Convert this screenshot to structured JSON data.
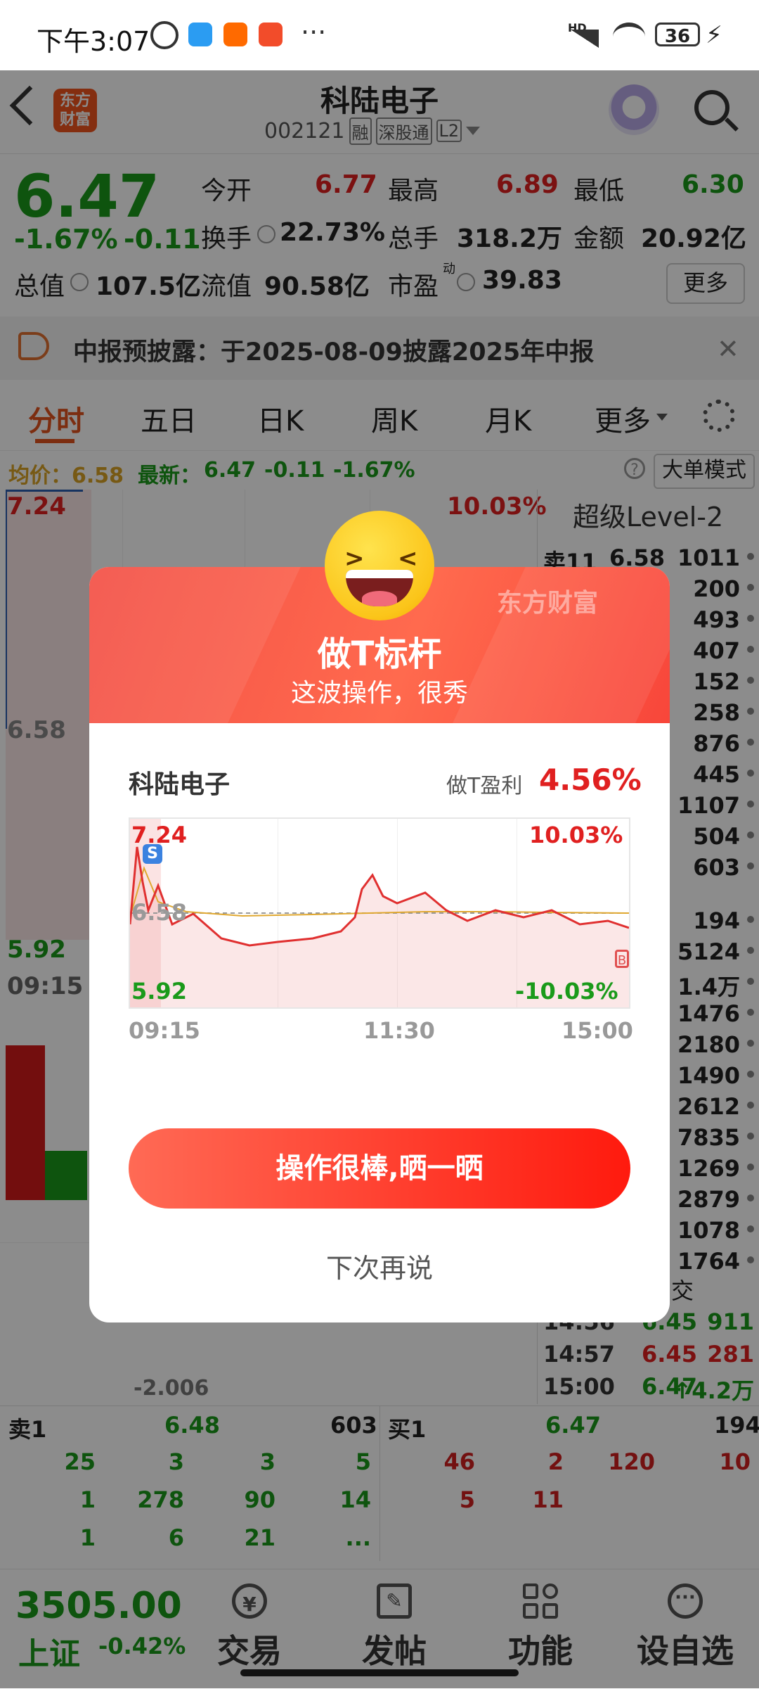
{
  "status_bar": {
    "time": "下午3:07",
    "dots": "···",
    "signal_label": "HD",
    "battery": "36"
  },
  "header": {
    "back_icon": "back-arrow-icon",
    "logo_text": "东方\n财富",
    "stock_name": "科陆电子",
    "stock_code": "002121",
    "tags": [
      "融",
      "深股通",
      "L2"
    ],
    "robot_icon": "robot-avatar-icon",
    "search_icon": "search-icon"
  },
  "quote": {
    "price": "6.47",
    "change_pct": "-1.67%",
    "change_abs": "-0.11",
    "fields": [
      {
        "label": "今开",
        "value": "6.77",
        "color": "#e02020"
      },
      {
        "label": "最高",
        "value": "6.89",
        "color": "#e02020"
      },
      {
        "label": "最低",
        "value": "6.30",
        "color": "#1a9a1a"
      },
      {
        "label": "换手",
        "value": "22.73%",
        "color": "#222222"
      },
      {
        "label": "总手",
        "value": "318.2万",
        "color": "#222222"
      },
      {
        "label": "金额",
        "value": "20.92亿",
        "color": "#222222"
      },
      {
        "label": "总值",
        "value": "107.5亿",
        "color": "#222222"
      },
      {
        "label": "流值",
        "value": "90.58亿",
        "color": "#222222"
      },
      {
        "label": "市盈",
        "value": "39.83",
        "color": "#222222"
      }
    ],
    "pe_superscript": "动",
    "more_button": "更多"
  },
  "notice": {
    "text": "中报预披露：于2025-08-09披露2025年中报"
  },
  "tabs": [
    "分时",
    "五日",
    "日K",
    "周K",
    "月K",
    "更多"
  ],
  "info_line": {
    "avg_label": "均价：6.58",
    "latest_label": "最新：",
    "latest": "6.47",
    "change": "-0.11",
    "pct": "-1.67%",
    "big_order_mode": "大单模式"
  },
  "main_chart": {
    "top_price": "7.24",
    "mid_price": "6.58",
    "low_price": "5.92",
    "top_pct": "10.03%",
    "start_time": "09:15",
    "indicator_value": "-2.006"
  },
  "level2": {
    "title": "超级Level-2",
    "sell_rows": [
      {
        "label": "卖11",
        "price": "6.58",
        "vol": "1011"
      },
      {
        "label": "",
        "price": "",
        "vol": "200"
      },
      {
        "label": "",
        "price": "",
        "vol": "493"
      },
      {
        "label": "",
        "price": "",
        "vol": "407"
      },
      {
        "label": "",
        "price": "",
        "vol": "152"
      },
      {
        "label": "",
        "price": "",
        "vol": "258"
      },
      {
        "label": "",
        "price": "",
        "vol": "876"
      },
      {
        "label": "",
        "price": "",
        "vol": "445"
      },
      {
        "label": "",
        "price": "",
        "vol": "1107"
      },
      {
        "label": "",
        "price": "",
        "vol": "504"
      },
      {
        "label": "",
        "price": "",
        "vol": "603"
      }
    ],
    "buy_rows": [
      "194",
      "5124",
      "1.4万",
      "1476",
      "2180",
      "1490",
      "2612",
      "7835",
      "1269",
      "2879",
      "1078",
      "1764"
    ],
    "trades_header": "交",
    "trades": [
      {
        "time": "14:56",
        "price": "6.45",
        "vol": "911",
        "color": "#1a9a1a"
      },
      {
        "time": "14:57",
        "price": "6.45",
        "vol": "281",
        "color": "#e02020"
      },
      {
        "time": "15:00",
        "price": "6.47",
        "vol": "↑4.2万",
        "color": "#1a9a1a"
      }
    ]
  },
  "order_book": {
    "sell1_label": "卖1",
    "sell1_price": "6.48",
    "sell1_vol": "603",
    "buy1_label": "买1",
    "buy1_price": "6.47",
    "buy1_vol": "194",
    "sell_queue": [
      [
        "25",
        "3",
        "3",
        "5"
      ],
      [
        "1",
        "278",
        "90",
        "14"
      ],
      [
        "1",
        "6",
        "21",
        "..."
      ]
    ],
    "buy_queue": [
      [
        "46",
        "2",
        "120",
        "10"
      ],
      [
        "5",
        "11",
        "",
        ""
      ]
    ]
  },
  "bottom_nav": {
    "index_value": "3505.00",
    "index_name": "上证",
    "index_change": "-0.42%",
    "items": [
      {
        "label": "交易",
        "icon": "yen-refresh-icon"
      },
      {
        "label": "发帖",
        "icon": "edit-icon"
      },
      {
        "label": "功能",
        "icon": "grid-icon"
      },
      {
        "label": "设自选",
        "icon": "more-dots-icon"
      }
    ]
  },
  "dialog": {
    "emoji": "laughing-emoji-icon",
    "watermark": "东方财富",
    "title": "做T标杆",
    "subtitle": "这波操作，很秀",
    "stock_name": "科陆电子",
    "profit_label": "做T盈利",
    "profit_value": "4.56%",
    "chart": {
      "top_price": "7.24",
      "mid_price": "6.58",
      "low_price": "5.92",
      "top_pct": "10.03%",
      "low_pct": "-10.03%",
      "times": [
        "09:15",
        "11:30",
        "15:00"
      ],
      "sell_marker": "S",
      "buy_marker": "B"
    },
    "share_button": "操作很棒,晒一晒",
    "later_button": "下次再说"
  }
}
